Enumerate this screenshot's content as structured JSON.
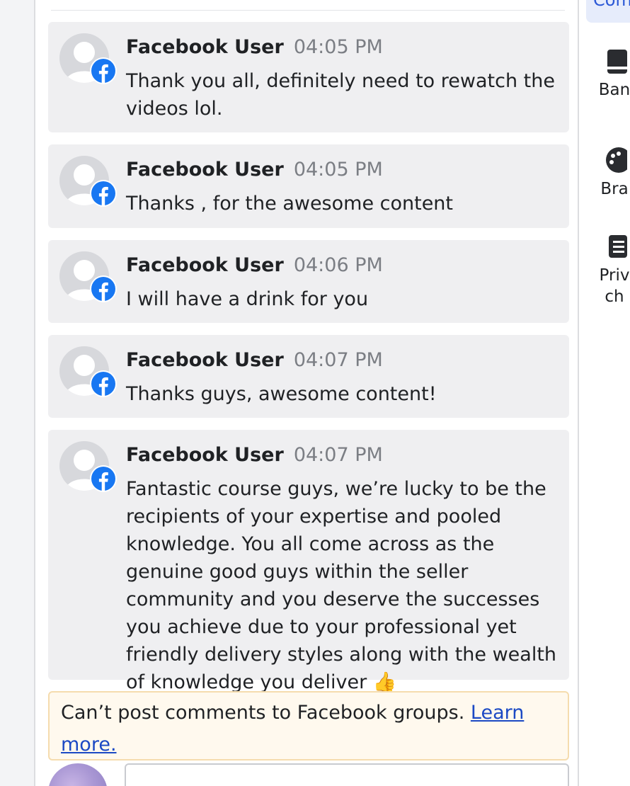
{
  "comments": [
    {
      "author": "Facebook User",
      "time": "04:05 PM",
      "text": "Thank you all, definitely need to rewatch the videos lol."
    },
    {
      "author": "Facebook User",
      "time": "04:05 PM",
      "text": "Thanks , for the awesome content"
    },
    {
      "author": "Facebook User",
      "time": "04:06 PM",
      "text": "I will have a drink for you"
    },
    {
      "author": "Facebook User",
      "time": "04:07 PM",
      "text": "Thanks guys, awesome content!"
    },
    {
      "author": "Facebook User",
      "time": "04:07 PM",
      "text": "Fantastic course guys, we’re lucky to be the recipients of your expertise and pooled knowledge. You all come across as the genuine good guys within the seller community and you deserve the successes you achieve due to your professional yet friendly delivery styles along with the wealth of knowledge you deliver 👍"
    }
  ],
  "notice": {
    "text": "Can’t post comments to Facebook groups.",
    "link": "Learn more."
  },
  "right_rail": {
    "top_button": "Com",
    "items": [
      {
        "label": "Ban",
        "icon": "banner-icon"
      },
      {
        "label": "Bra",
        "icon": "palette-icon"
      },
      {
        "label": "Priv ch",
        "icon": "checklist-icon"
      }
    ]
  },
  "colors": {
    "facebook_blue": "#1877f2",
    "link_blue": "#1b49c4",
    "notice_bg": "#fff9ee",
    "comment_bg": "#efeff1"
  }
}
